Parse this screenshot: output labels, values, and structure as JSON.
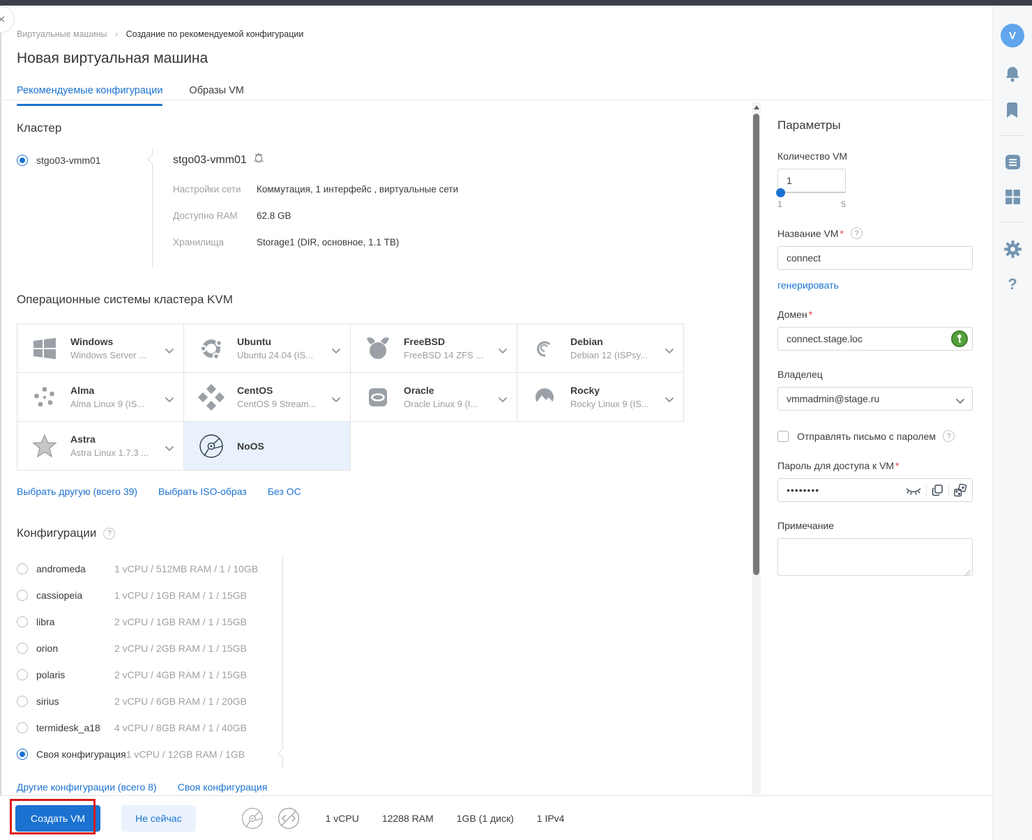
{
  "breadcrumb": {
    "items": [
      "Виртуальные машины",
      "Создание по рекомендуемой конфигурации"
    ],
    "separator": "›"
  },
  "page_title": "Новая виртуальная машина",
  "tabs": [
    {
      "label": "Рекомендуемые конфигурации",
      "active": true
    },
    {
      "label": "Образы VM",
      "active": false
    }
  ],
  "cluster": {
    "heading": "Кластер",
    "option": {
      "label": "stgo03-vmm01",
      "selected": true
    },
    "details": {
      "title": "stgo03-vmm01",
      "rows": [
        {
          "label": "Настройки сети",
          "value": "Коммутация, 1 интерфейс , виртуальные сети"
        },
        {
          "label": "Доступно RAM",
          "value": "62.8 GB"
        },
        {
          "label": "Хранилища",
          "value": "Storage1 (DIR, основное, 1.1 TB)"
        }
      ]
    }
  },
  "os": {
    "heading": "Операционные системы кластера KVM",
    "items": [
      {
        "name": "Windows",
        "version": "Windows Server ...",
        "icon": "windows-icon"
      },
      {
        "name": "Ubuntu",
        "version": "Ubuntu 24.04 (IS...",
        "icon": "ubuntu-icon"
      },
      {
        "name": "FreeBSD",
        "version": "FreeBSD 14 ZFS ...",
        "icon": "freebsd-icon"
      },
      {
        "name": "Debian",
        "version": "Debian 12 (ISPsy...",
        "icon": "debian-icon"
      },
      {
        "name": "Alma",
        "version": "Alma Linux 9 (IS...",
        "icon": "alma-icon"
      },
      {
        "name": "CentOS",
        "version": "CentOS 9 Stream...",
        "icon": "centos-icon"
      },
      {
        "name": "Oracle",
        "version": "Oracle Linux 9 (I...",
        "icon": "oracle-icon"
      },
      {
        "name": "Rocky",
        "version": "Rocky Linux 9 (IS...",
        "icon": "rocky-icon"
      },
      {
        "name": "Astra",
        "version": "Astra Linux 1.7.3 ...",
        "icon": "astra-icon"
      },
      {
        "name": "NoOS",
        "version": "",
        "icon": "disc-icon",
        "selected": true
      }
    ],
    "links": [
      "Выбрать другую (всего 39)",
      "Выбрать ISO-образ",
      "Без ОС"
    ]
  },
  "configs": {
    "heading": "Конфигурации",
    "items": [
      {
        "name": "andromeda",
        "spec": "1 vCPU / 512MB RAM / 1 / 10GB",
        "selected": false
      },
      {
        "name": "cassiopeia",
        "spec": "1 vCPU / 1GB RAM / 1 / 15GB",
        "selected": false
      },
      {
        "name": "libra",
        "spec": "2 vCPU / 1GB RAM / 1 / 15GB",
        "selected": false
      },
      {
        "name": "orion",
        "spec": "2 vCPU / 2GB RAM / 1 / 15GB",
        "selected": false
      },
      {
        "name": "polaris",
        "spec": "2 vCPU / 4GB RAM / 1 / 15GB",
        "selected": false
      },
      {
        "name": "sirius",
        "spec": "2 vCPU / 6GB RAM / 1 / 20GB",
        "selected": false
      },
      {
        "name": "termidesk_a18",
        "spec": "4 vCPU / 8GB RAM / 1 / 40GB",
        "selected": false
      },
      {
        "name": "Своя конфигурация",
        "spec": "1 vCPU / 12GB RAM / 1GB",
        "selected": true
      }
    ],
    "links": [
      "Другие конфигурации (всего 8)",
      "Своя конфигурация"
    ]
  },
  "params": {
    "heading": "Параметры",
    "vm_count": {
      "label": "Количество VM",
      "value": "1",
      "min_label": "1",
      "max_label": "5"
    },
    "vm_name": {
      "label": "Название VM",
      "value": "connect",
      "generate_link": "генерировать"
    },
    "domain": {
      "label": "Домен",
      "value": "connect.stage.loc"
    },
    "owner": {
      "label": "Владелец",
      "value": "vmmadmin@stage.ru"
    },
    "send_password_email": {
      "label": "Отправлять письмо с паролем",
      "checked": false
    },
    "password": {
      "label": "Пароль для доступа к VM",
      "value": "••••••••"
    },
    "note": {
      "label": "Примечание",
      "value": ""
    }
  },
  "footer": {
    "create_label": "Создать VM",
    "later_label": "Не сейчас",
    "summary": [
      "1 vCPU",
      "12288 RAM",
      "1GB (1 диск)",
      "1 IPv4"
    ]
  },
  "sidebar": {
    "avatar_initial": "V",
    "icons": [
      "bell-icon",
      "bookmark-icon",
      "documents-icon",
      "apps-grid-icon",
      "settings-icon",
      "help-icon"
    ],
    "help_glyph": "?"
  },
  "misc": {
    "required_mark": "*",
    "help_mark": "?",
    "close_glyph": "✕"
  },
  "colors": {
    "accent_blue": "#1b72d0",
    "selected_os_bg": "#e8f1fc",
    "annotation_red": "#dc1a1a",
    "required_red": "#e23b3f",
    "topbar": "#3a3f4a",
    "avatar_bg": "#61a6ec"
  }
}
